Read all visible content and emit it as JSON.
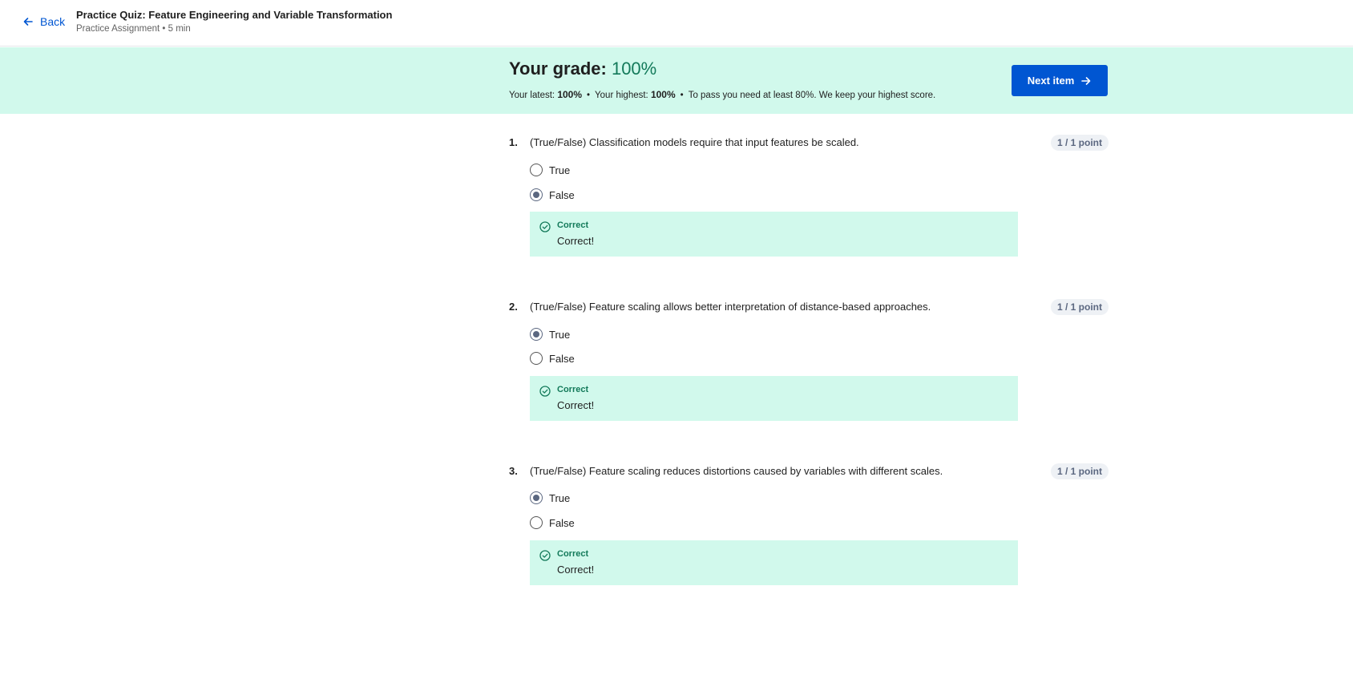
{
  "header": {
    "back_label": "Back",
    "title": "Practice Quiz: Feature Engineering and Variable Transformation",
    "subtitle": "Practice Assignment • 5 min"
  },
  "grade": {
    "label": "Your grade: ",
    "value": "100%",
    "latest_label": "Your latest: ",
    "latest_value": "100%",
    "highest_label": "Your highest: ",
    "highest_value": "100%",
    "pass_note": "To pass you need at least 80%. We keep your highest score.",
    "next_label": "Next item"
  },
  "questions": [
    {
      "number": "1.",
      "text": "(True/False) Classification models require that input features be scaled.",
      "points": "1 / 1 point",
      "options": [
        {
          "label": "True",
          "selected": false
        },
        {
          "label": "False",
          "selected": true
        }
      ],
      "feedback_label": "Correct",
      "feedback_text": "Correct!"
    },
    {
      "number": "2.",
      "text": "(True/False) Feature scaling allows better interpretation of distance-based approaches.",
      "points": "1 / 1 point",
      "options": [
        {
          "label": "True",
          "selected": true
        },
        {
          "label": "False",
          "selected": false
        }
      ],
      "feedback_label": "Correct",
      "feedback_text": "Correct!"
    },
    {
      "number": "3.",
      "text": "(True/False) Feature scaling reduces distortions caused by variables with different scales.",
      "points": "1 / 1 point",
      "options": [
        {
          "label": "True",
          "selected": true
        },
        {
          "label": "False",
          "selected": false
        }
      ],
      "feedback_label": "Correct",
      "feedback_text": "Correct!"
    }
  ],
  "colors": {
    "accent": "#0056d2",
    "success_bg": "#d1f9ec",
    "success_text": "#137a5a"
  },
  "icons": {
    "back": "arrow-left-icon",
    "next": "arrow-right-icon",
    "feedback": "check-circle-icon"
  }
}
